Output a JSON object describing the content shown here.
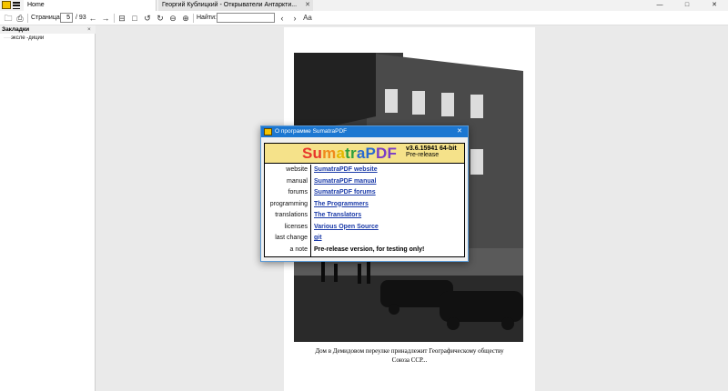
{
  "window": {
    "tabs": [
      {
        "label": "Home"
      },
      {
        "label": "Георгий Кублицкий - Открыватели Антаркти..."
      }
    ],
    "controls": {
      "minimize": "—",
      "maximize": "□",
      "close": "✕"
    }
  },
  "toolbar": {
    "page_label": "Страница:",
    "page_value": "5",
    "page_total": "/ 93",
    "find_label": "Найти:",
    "find_value": ""
  },
  "sidebar": {
    "title": "Закладки",
    "close": "×",
    "items": [
      "эксле -диции"
    ]
  },
  "document": {
    "caption_line1": "Дом в Демидовом переулке принадлежит Географическому обществу",
    "caption_line2": "Союза ССР..."
  },
  "dialog": {
    "title": "О программе SumatraPDF",
    "close": "✕",
    "logo_letters": [
      {
        "ch": "S",
        "color": "#e8372b"
      },
      {
        "ch": "u",
        "color": "#e8372b"
      },
      {
        "ch": "m",
        "color": "#f08a1c"
      },
      {
        "ch": "a",
        "color": "#e3b800"
      },
      {
        "ch": "t",
        "color": "#2e9f3c"
      },
      {
        "ch": "r",
        "color": "#2e9f3c"
      },
      {
        "ch": "a",
        "color": "#2a6ad0"
      },
      {
        "ch": "P",
        "color": "#2a6ad0"
      },
      {
        "ch": "D",
        "color": "#7a3cc6"
      },
      {
        "ch": "F",
        "color": "#7a3cc6"
      }
    ],
    "version": "v3.6.15941 64-bit",
    "prerelease": "Pre-release",
    "rows": [
      {
        "label": "website",
        "value": "SumatraPDF website",
        "link": true
      },
      {
        "label": "manual",
        "value": "SumatraPDF manual",
        "link": true
      },
      {
        "label": "forums",
        "value": "SumatraPDF forums",
        "link": true
      },
      {
        "label": "programming",
        "value": "The Programmers",
        "link": true
      },
      {
        "label": "translations",
        "value": "The Translators",
        "link": true
      },
      {
        "label": "licenses",
        "value": "Various Open Source",
        "link": true
      },
      {
        "label": "last change",
        "value": "git",
        "link": true
      },
      {
        "label": "a note",
        "value": "Pre-release version, for testing only!",
        "link": false
      }
    ]
  },
  "colors": {
    "accent": "#1c77d1",
    "logo_band": "#f5e28a",
    "link": "#1a3aa8"
  }
}
